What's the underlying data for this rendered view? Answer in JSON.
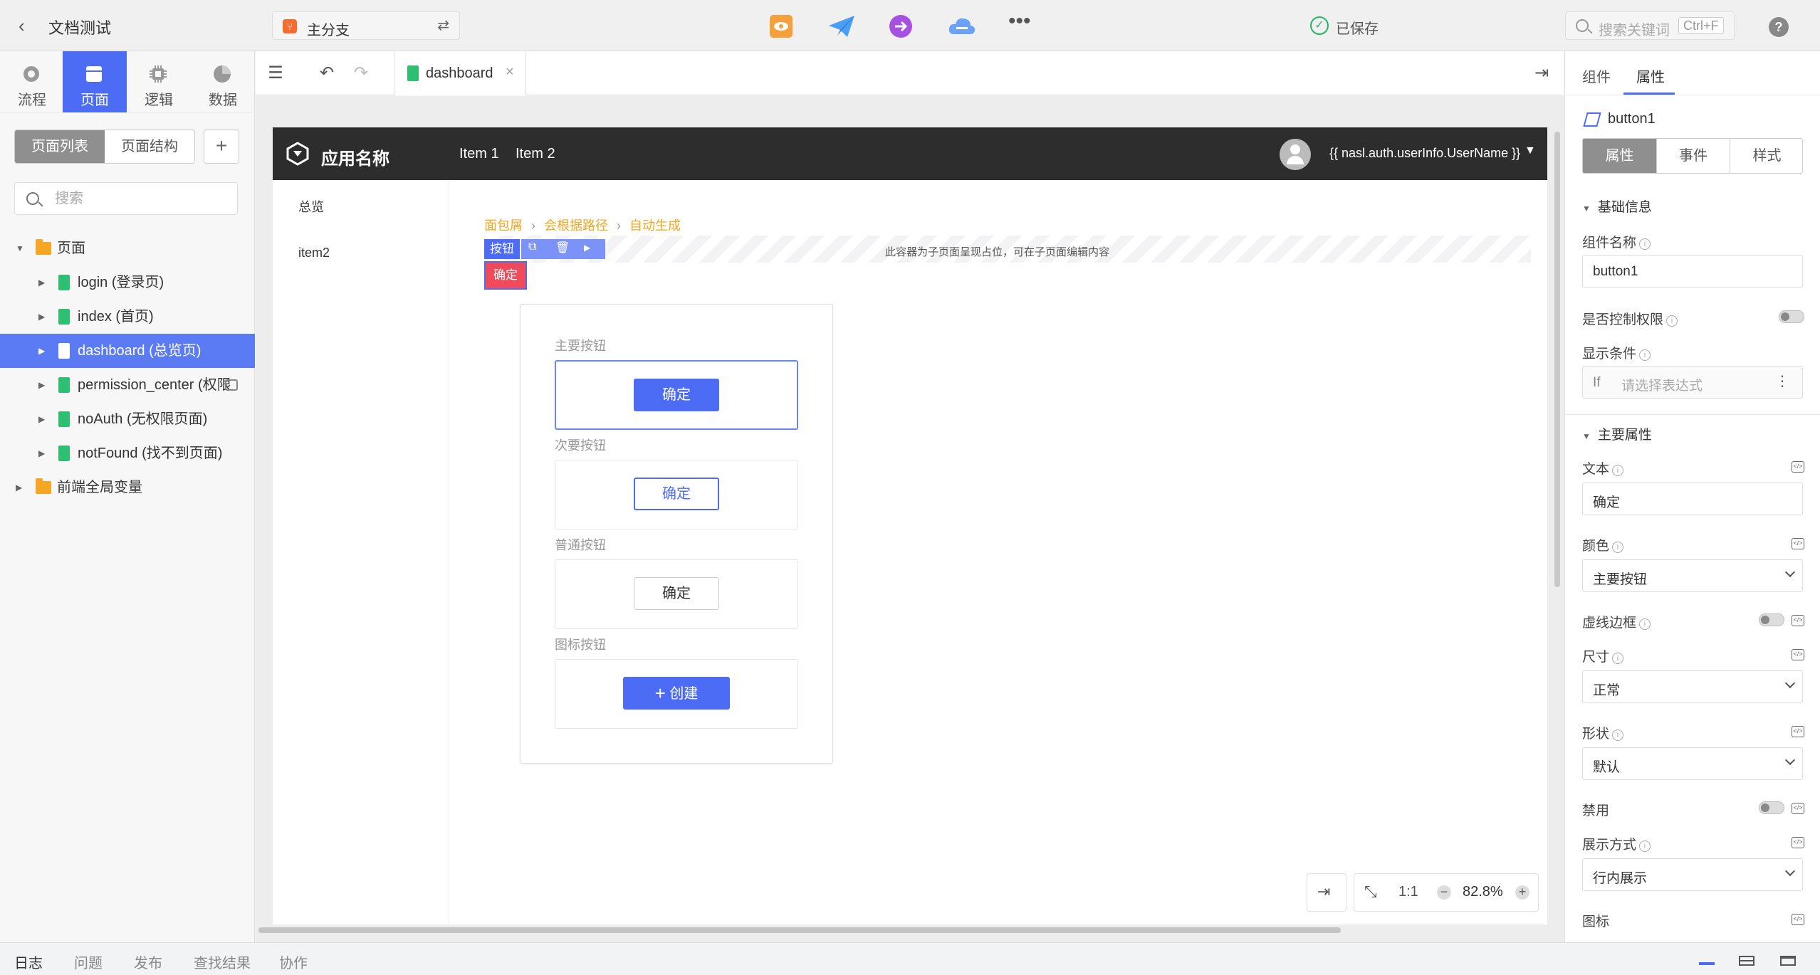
{
  "topbar": {
    "title": "文档测试",
    "branch": "主分支",
    "save_status": "已保存",
    "search_placeholder": "搜索关键词",
    "search_shortcut": "Ctrl+F"
  },
  "leftbar": {
    "modes": [
      {
        "label": "流程",
        "icon": "flow-icon"
      },
      {
        "label": "页面",
        "icon": "page-icon",
        "active": true
      },
      {
        "label": "逻辑",
        "icon": "logic-chip-icon"
      },
      {
        "label": "数据",
        "icon": "data-pie-icon"
      }
    ],
    "seg": {
      "list": "页面列表",
      "structure": "页面结构"
    },
    "search_placeholder": "搜索",
    "tree": {
      "pages_folder": "页面",
      "pages": [
        {
          "label": "login (登录页)"
        },
        {
          "label": "index (首页)"
        },
        {
          "label": "dashboard (总览页)",
          "selected": true
        },
        {
          "label": "permission_center (权限",
          "locked": true
        },
        {
          "label": "noAuth (无权限页面)"
        },
        {
          "label": "notFound (找不到页面)"
        }
      ],
      "globals_folder": "前端全局变量"
    }
  },
  "editor": {
    "file_tab": "dashboard"
  },
  "app_preview": {
    "app_name": "应用名称",
    "nav": [
      "Item 1",
      "Item 2"
    ],
    "user_name": "{{ nasl.auth.userInfo.UserName }}",
    "side_menu": [
      "总览",
      "item2"
    ],
    "breadcrumb": [
      "面包屑",
      "会根据路径",
      "自动生成"
    ],
    "placeholder_text": "此容器为子页面呈现占位，可在子页面编辑内容",
    "selection_tag": "按钮",
    "selected_button": "确定",
    "demo": {
      "primary_label": "主要按钮",
      "primary_btn": "确定",
      "secondary_label": "次要按钮",
      "secondary_btn": "确定",
      "normal_label": "普通按钮",
      "normal_btn": "确定",
      "icon_label": "图标按钮",
      "icon_btn": "创建"
    }
  },
  "zoom": {
    "ratio_label": "1:1",
    "value": "82.8%"
  },
  "rightbar": {
    "tabs": [
      "组件",
      "属性"
    ],
    "component_name": "button1",
    "seg": [
      "属性",
      "事件",
      "样式"
    ],
    "basic_section": "基础信息",
    "name_label": "组件名称",
    "name_value": "button1",
    "auth_label": "是否控制权限",
    "display_label": "显示条件",
    "display_if": "If",
    "display_placeholder": "请选择表达式",
    "main_section": "主要属性",
    "text_label": "文本",
    "text_value": "确定",
    "color_label": "颜色",
    "color_value": "主要按钮",
    "dashed_label": "虚线边框",
    "size_label": "尺寸",
    "size_value": "正常",
    "shape_label": "形状",
    "shape_value": "默认",
    "disabled_label": "禁用",
    "display_mode_label": "展示方式",
    "display_mode_value": "行内展示",
    "icon_label": "图标"
  },
  "bottombar": {
    "tabs": [
      "日志",
      "问题",
      "发布",
      "查找结果",
      "协作"
    ]
  },
  "colors": {
    "accent": "#4d6cf5",
    "danger": "#f04b5a",
    "breadcrumb": "#f5a623",
    "success": "#28b463"
  }
}
